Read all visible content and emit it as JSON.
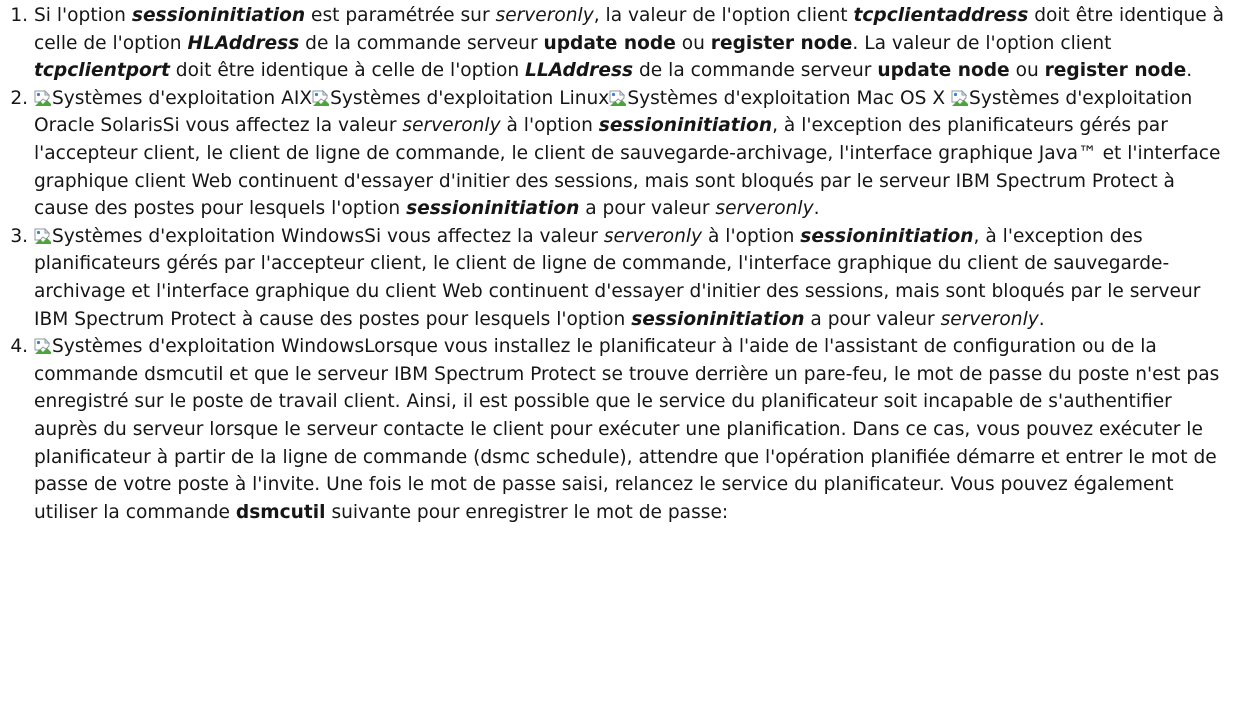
{
  "notes": [
    {
      "segments": [
        {
          "t": "Si l'option ",
          "s": "n"
        },
        {
          "t": "sessioninitiation",
          "s": "bi"
        },
        {
          "t": " est paramétrée sur ",
          "s": "n"
        },
        {
          "t": "serveronly",
          "s": "i"
        },
        {
          "t": ", la valeur de l'option client ",
          "s": "n"
        },
        {
          "t": "tcpclientaddress",
          "s": "bi"
        },
        {
          "t": " doit être identique à celle de l'option ",
          "s": "n"
        },
        {
          "t": "HLAddress",
          "s": "bi"
        },
        {
          "t": " de la commande serveur ",
          "s": "n"
        },
        {
          "t": "update node",
          "s": "b"
        },
        {
          "t": " ou ",
          "s": "n"
        },
        {
          "t": "register node",
          "s": "b"
        },
        {
          "t": ". La valeur de l'option client ",
          "s": "n"
        },
        {
          "t": "tcpclientport",
          "s": "bi"
        },
        {
          "t": " doit être identique à celle de l'option ",
          "s": "n"
        },
        {
          "t": "LLAddress",
          "s": "bi"
        },
        {
          "t": " de la commande serveur ",
          "s": "n"
        },
        {
          "t": "update node",
          "s": "b"
        },
        {
          "t": " ou ",
          "s": "n"
        },
        {
          "t": "register node",
          "s": "b"
        },
        {
          "t": ".",
          "s": "n"
        }
      ]
    },
    {
      "segments": [
        {
          "s": "icon",
          "icon": "broken-image-icon"
        },
        {
          "t": "Systèmes d'exploitation AIX",
          "s": "n"
        },
        {
          "s": "icon",
          "icon": "broken-image-icon"
        },
        {
          "t": "Systèmes d'exploitation Linux",
          "s": "n"
        },
        {
          "s": "icon",
          "icon": "broken-image-icon"
        },
        {
          "t": "Systèmes d'exploitation Mac OS X ",
          "s": "n"
        },
        {
          "s": "icon",
          "icon": "broken-image-icon"
        },
        {
          "t": "Systèmes d'exploitation Oracle Solaris",
          "s": "n"
        },
        {
          "t": "Si vous affectez la valeur ",
          "s": "n"
        },
        {
          "t": "serveronly",
          "s": "i"
        },
        {
          "t": " à l'option ",
          "s": "n"
        },
        {
          "t": "sessioninitiation",
          "s": "bi"
        },
        {
          "t": ", à l'exception des planificateurs gérés par l'accepteur client, le client de ligne de commande, le client de sauvegarde-archivage, l'interface graphique Java™ et l'interface graphique client Web continuent d'essayer d'initier des sessions, mais sont bloqués par le serveur IBM Spectrum Protect à cause des postes pour lesquels l'option ",
          "s": "n"
        },
        {
          "t": "sessioninitiation",
          "s": "bi"
        },
        {
          "t": " a pour valeur ",
          "s": "n"
        },
        {
          "t": "serveronly",
          "s": "i"
        },
        {
          "t": ".",
          "s": "n"
        }
      ]
    },
    {
      "segments": [
        {
          "s": "icon",
          "icon": "broken-image-icon"
        },
        {
          "t": "Systèmes d'exploitation Windows",
          "s": "n"
        },
        {
          "t": "Si vous affectez la valeur ",
          "s": "n"
        },
        {
          "t": "serveronly",
          "s": "i"
        },
        {
          "t": " à l'option ",
          "s": "n"
        },
        {
          "t": "sessioninitiation",
          "s": "bi"
        },
        {
          "t": ", à l'exception des planificateurs gérés par l'accepteur client, le client de ligne de commande, l'interface graphique du client de sauvegarde-archivage et l'interface graphique du client Web continuent d'essayer d'initier des sessions, mais sont bloqués par le serveur IBM Spectrum Protect à cause des postes pour lesquels l'option ",
          "s": "n"
        },
        {
          "t": "sessioninitiation",
          "s": "bi"
        },
        {
          "t": " a pour valeur ",
          "s": "n"
        },
        {
          "t": "serveronly",
          "s": "i"
        },
        {
          "t": ".",
          "s": "n"
        }
      ]
    },
    {
      "segments": [
        {
          "s": "icon",
          "icon": "broken-image-icon"
        },
        {
          "t": "Systèmes d'exploitation Windows",
          "s": "n"
        },
        {
          "t": "Lorsque vous installez le planificateur à l'aide de l'assistant de configuration ou de la commande dsmcutil et que le serveur IBM Spectrum Protect se trouve derrière un pare-feu, le mot de passe du poste n'est pas enregistré sur le poste de travail client. Ainsi, il est possible que le service du planificateur soit incapable de s'authentifier auprès du serveur lorsque le serveur contacte le client pour exécuter une planification. Dans ce cas, vous pouvez exécuter le planificateur à partir de la ligne de commande (dsmc schedule), attendre que l'opération planifiée démarre et entrer le mot de passe de votre poste à l'invite. Une fois le mot de passe saisi, relancez le service du planificateur. Vous pouvez également utiliser la commande ",
          "s": "n"
        },
        {
          "t": "dsmcutil",
          "s": "b"
        },
        {
          "t": " suivante pour enregistrer le mot de passe:",
          "s": "n"
        }
      ]
    }
  ]
}
